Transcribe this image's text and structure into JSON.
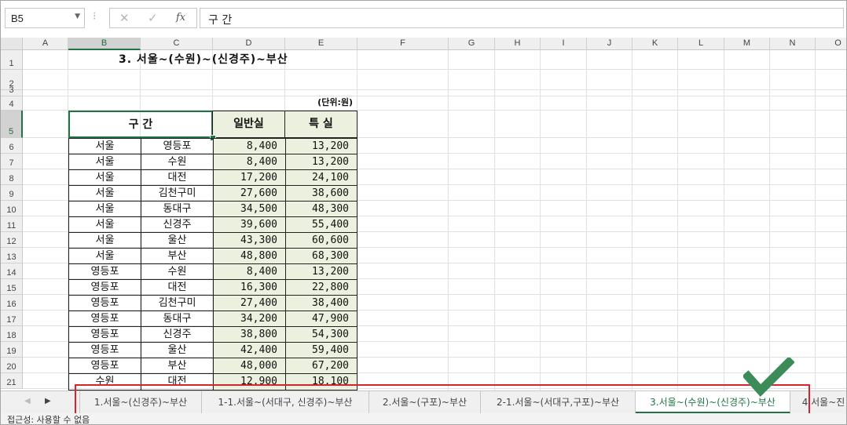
{
  "formula_bar": {
    "name_box": "B5",
    "formula": "구 간",
    "cancel": "✕",
    "enter": "✓",
    "fx": "fx"
  },
  "columns": [
    "A",
    "B",
    "C",
    "D",
    "E",
    "F",
    "G",
    "H",
    "I",
    "J",
    "K",
    "L",
    "M",
    "N",
    "O"
  ],
  "rows": [
    "1",
    "2",
    "3",
    "4",
    "5",
    "6",
    "7",
    "8",
    "9",
    "10",
    "11",
    "12",
    "13",
    "14",
    "15",
    "16",
    "17",
    "18",
    "19",
    "20",
    "21"
  ],
  "sheet": {
    "title": "3.  서울~(수원)~(신경주)~부산",
    "unit": "(단위:원)",
    "headers": {
      "route": "구 간",
      "normal": "일반실",
      "special": "특 실"
    },
    "data": [
      [
        "서울",
        "영등포",
        "8,400",
        "13,200"
      ],
      [
        "서울",
        "수원",
        "8,400",
        "13,200"
      ],
      [
        "서울",
        "대전",
        "17,200",
        "24,100"
      ],
      [
        "서울",
        "김천구미",
        "27,600",
        "38,600"
      ],
      [
        "서울",
        "동대구",
        "34,500",
        "48,300"
      ],
      [
        "서울",
        "신경주",
        "39,600",
        "55,400"
      ],
      [
        "서울",
        "울산",
        "43,300",
        "60,600"
      ],
      [
        "서울",
        "부산",
        "48,800",
        "68,300"
      ],
      [
        "영등포",
        "수원",
        "8,400",
        "13,200"
      ],
      [
        "영등포",
        "대전",
        "16,300",
        "22,800"
      ],
      [
        "영등포",
        "김천구미",
        "27,400",
        "38,400"
      ],
      [
        "영등포",
        "동대구",
        "34,200",
        "47,900"
      ],
      [
        "영등포",
        "신경주",
        "38,800",
        "54,300"
      ],
      [
        "영등포",
        "울산",
        "42,400",
        "59,400"
      ],
      [
        "영등포",
        "부산",
        "48,000",
        "67,200"
      ],
      [
        "수원",
        "대전",
        "12,900",
        "18,100"
      ]
    ]
  },
  "tabs": [
    {
      "label": "1.서울~(신경주)~부산",
      "active": false
    },
    {
      "label": "1-1.서울~(서대구, 신경주)~부산",
      "active": false
    },
    {
      "label": "2.서울~(구포)~부산",
      "active": false
    },
    {
      "label": "2-1.서울~(서대구,구포)~부산",
      "active": false
    },
    {
      "label": "3.서울~(수원)~(신경주)~부산",
      "active": true
    },
    {
      "label": "4.서울~진",
      "active": false
    }
  ],
  "status": "접근성: 사용할 수 없음",
  "colors": {
    "accent": "#217346",
    "highlight_box": "#d9232d",
    "checkmark": "#3c8c5a",
    "value_fill": "#ebf1de"
  }
}
